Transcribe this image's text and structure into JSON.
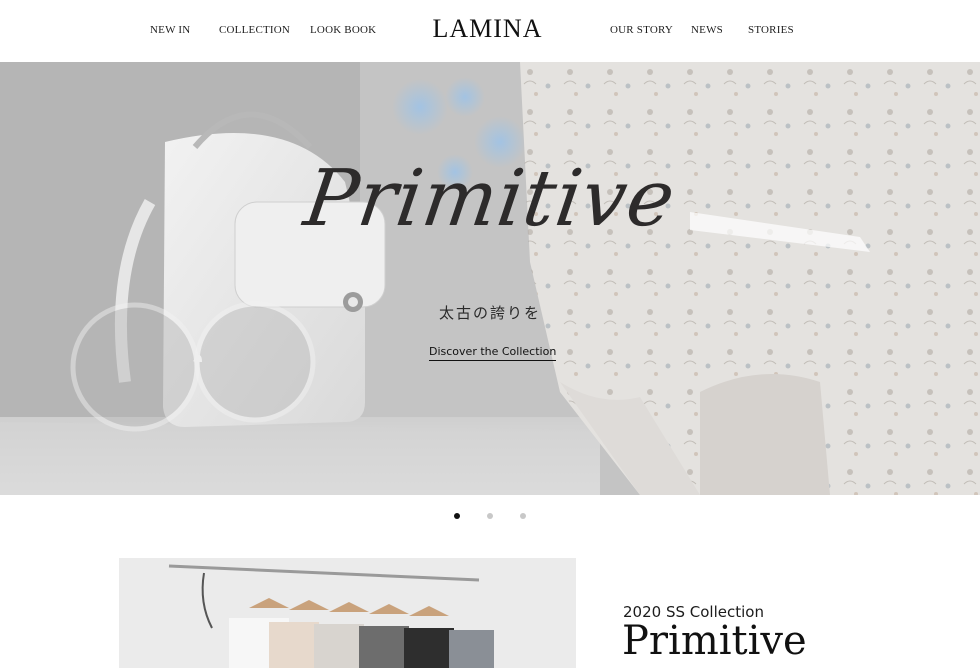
{
  "header": {
    "nav_left": [
      "NEW IN",
      "COLLECTION",
      "LOOK BOOK"
    ],
    "logo": "LAMINA",
    "nav_right": [
      "OUR STORY",
      "NEWS",
      "STORIES"
    ]
  },
  "hero": {
    "title": "Primitive",
    "subtitle": "太古の誇りを",
    "cta": "Discover the Collection"
  },
  "carousel": {
    "slide_count": 3,
    "active_index": 0,
    "active_color": "#111111",
    "inactive_color": "#c8c8c8"
  },
  "collection": {
    "label": "2020 SS Collection",
    "title": "Primitive"
  }
}
